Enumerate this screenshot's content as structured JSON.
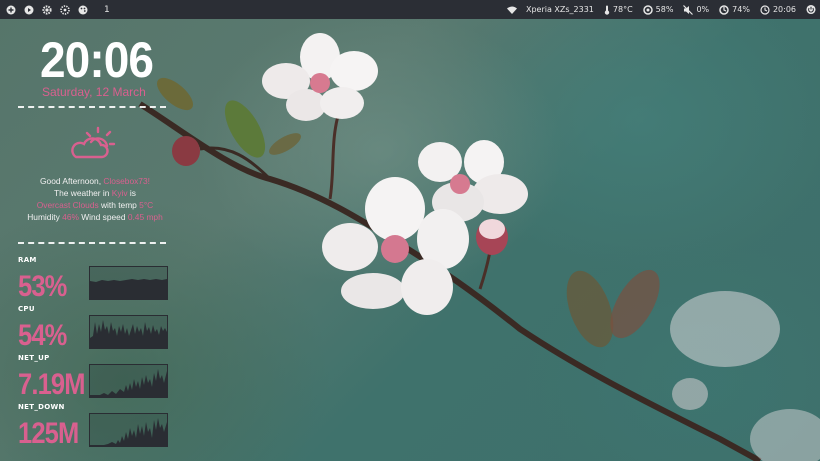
{
  "topbar": {
    "workspace": "1",
    "device": "Xperia XZs_2331",
    "temperature": "78°C",
    "cpu": "58%",
    "mute": "0%",
    "battery": "74%",
    "time": "20:06"
  },
  "conky": {
    "clock": "20:06",
    "date": "Saturday, 12 March",
    "weather": {
      "greeting": "Good Afternoon, ",
      "user": "Closebox73!",
      "line2_prefix": "The weather in ",
      "city": "Kyiv",
      "line2_suffix": " is",
      "condition": "Overcast Clouds",
      "line3_mid": " with temp ",
      "temp": "5°C",
      "humidity_label": "Humidity ",
      "humidity": "46%",
      "wind_label": " Wind speed ",
      "wind": "0.45 mph"
    },
    "stats": [
      {
        "label": "RAM",
        "value": "53%"
      },
      {
        "label": "CPU",
        "value": "54%"
      },
      {
        "label": "NET_UP",
        "value": "7.19M"
      },
      {
        "label": "NET_DOWN",
        "value": "125M"
      }
    ]
  },
  "colors": {
    "accent": "#d9608f",
    "bar": "#2b2e35"
  }
}
